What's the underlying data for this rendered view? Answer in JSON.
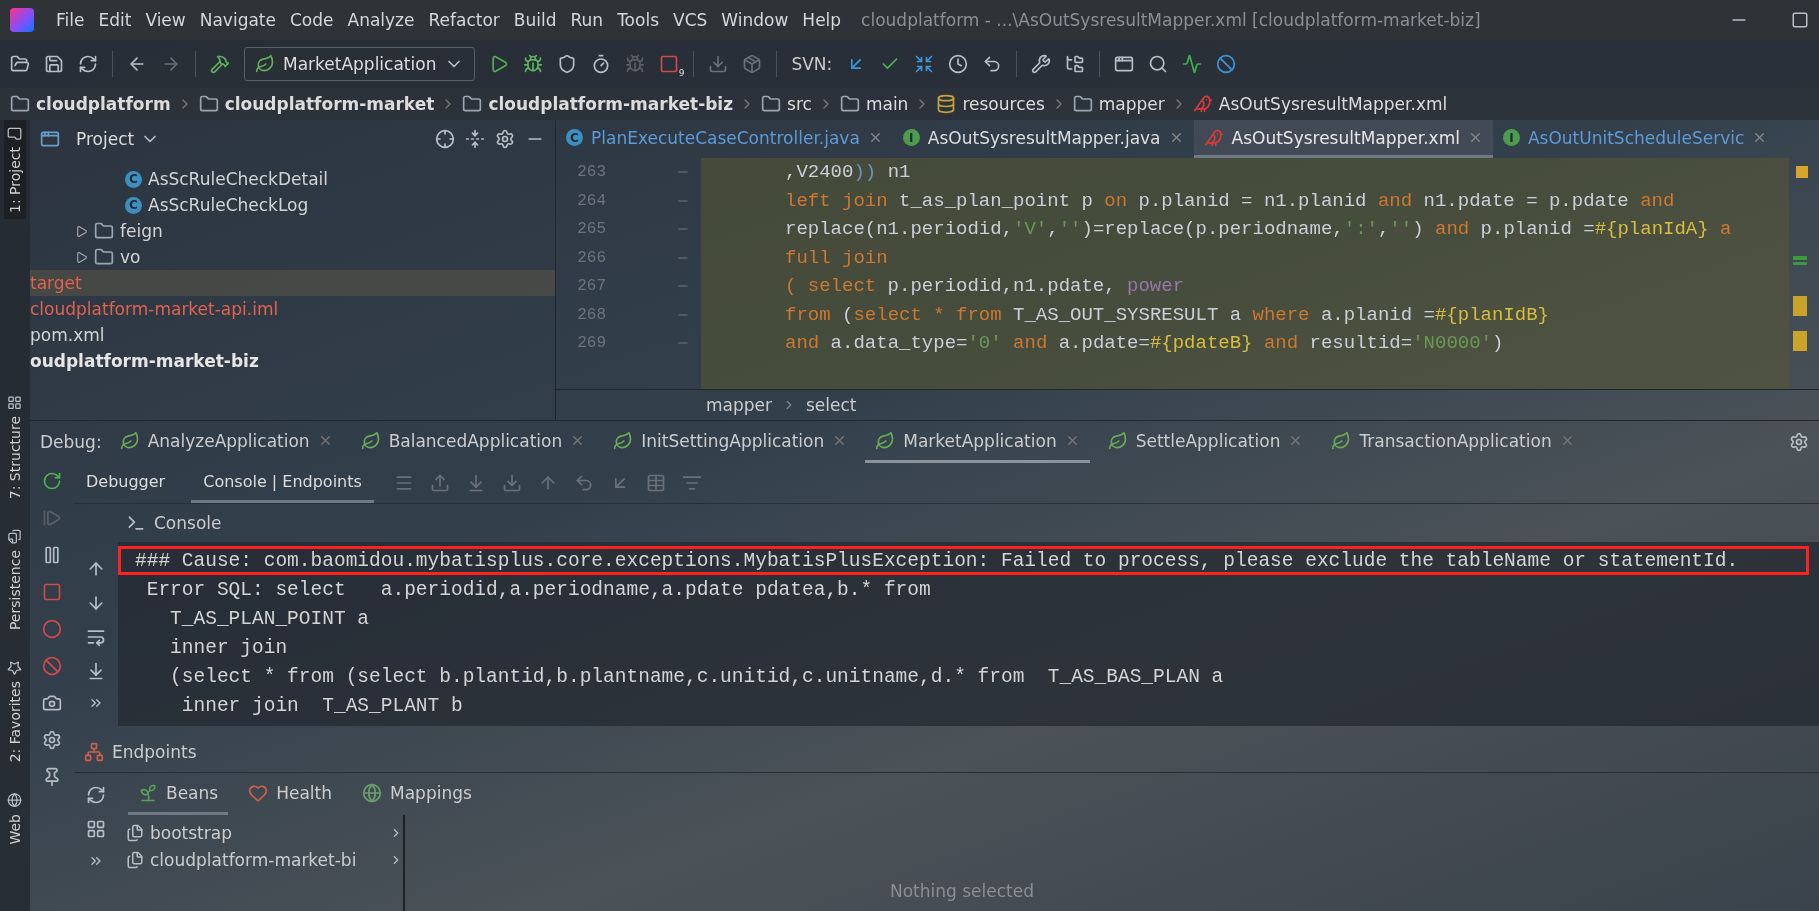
{
  "menu_bar": {
    "items": [
      "File",
      "Edit",
      "View",
      "Navigate",
      "Code",
      "Analyze",
      "Refactor",
      "Build",
      "Run",
      "Tools",
      "VCS",
      "Window",
      "Help"
    ],
    "title": "cloudplatform - ...\\AsOutSysresultMapper.xml [cloudplatform-market-biz]"
  },
  "toolbar": {
    "run_configuration": "MarketApplication",
    "stop_badge": "9",
    "svn_label": "SVN:"
  },
  "breadcrumb": [
    {
      "label": "cloudplatform",
      "kind": "module"
    },
    {
      "label": "cloudplatform-market",
      "kind": "module"
    },
    {
      "label": "cloudplatform-market-biz",
      "kind": "module"
    },
    {
      "label": "src",
      "kind": "folder"
    },
    {
      "label": "main",
      "kind": "folder"
    },
    {
      "label": "resources",
      "kind": "resources"
    },
    {
      "label": "mapper",
      "kind": "folder"
    },
    {
      "label": "AsOutSysresultMapper.xml",
      "kind": "xml"
    }
  ],
  "side_tool_tabs": [
    {
      "label": "1: Project",
      "kind": "project",
      "selected": true
    },
    {
      "label": "7: Structure",
      "kind": "structure",
      "selected": false
    },
    {
      "label": "Persistence",
      "kind": "persistence",
      "selected": false
    },
    {
      "label": "2: Favorites",
      "kind": "favorites",
      "selected": false
    },
    {
      "label": "Web",
      "kind": "web",
      "selected": false
    }
  ],
  "project_panel": {
    "title": "Project",
    "rows": [
      {
        "label": "AsScRuleCheckDetail",
        "kind": "class",
        "icon_letter": "C",
        "selected": false,
        "color": "#d4d4d4"
      },
      {
        "label": "AsScRuleCheckLog",
        "kind": "class",
        "icon_letter": "C",
        "selected": false,
        "color": "#d4d4d4"
      },
      {
        "label": "feign",
        "kind": "folder",
        "expanded": false,
        "selected": false,
        "color": "#d4d4d4"
      },
      {
        "label": "vo",
        "kind": "folder",
        "expanded": false,
        "selected": false,
        "color": "#d4d4d4"
      },
      {
        "label": "target",
        "kind": "file",
        "selected": true,
        "color": "#e0634f"
      },
      {
        "label": "cloudplatform-market-api.iml",
        "kind": "file",
        "selected": false,
        "color": "#e0634f"
      },
      {
        "label": "pom.xml",
        "kind": "file",
        "selected": false,
        "color": "#d4d4d4"
      },
      {
        "label": "oudplatform-market-biz",
        "kind": "module",
        "selected": false,
        "color": "#e6e6e6"
      }
    ]
  },
  "editor": {
    "tabs": [
      {
        "label": "PlanExecuteCaseController.java",
        "kind": "class",
        "icon_letter": "C",
        "selected": false,
        "color": "#5d9ad6"
      },
      {
        "label": "AsOutSysresultMapper.java",
        "kind": "interface",
        "icon_letter": "I",
        "selected": false,
        "color": "#dcdcdc"
      },
      {
        "label": "AsOutSysresultMapper.xml",
        "kind": "xml",
        "selected": true,
        "color": "#e6e6e6"
      },
      {
        "label": "AsOutUnitScheduleServic",
        "kind": "interface",
        "icon_letter": "I",
        "selected": false,
        "color": "#5d9ad6"
      }
    ],
    "lines": [
      {
        "number": "263",
        "tokens": [
          {
            "text": ",V2400",
            "kind": "plain"
          },
          {
            "text": "))",
            "kind": "paren"
          },
          {
            "text": " n1",
            "kind": "plain"
          }
        ]
      },
      {
        "number": "264",
        "tokens": [
          {
            "text": "left join",
            "kind": "kw"
          },
          {
            "text": " t_as_plan_point p ",
            "kind": "plain"
          },
          {
            "text": "on",
            "kind": "kw"
          },
          {
            "text": " p.planid = n1.planid ",
            "kind": "plain"
          },
          {
            "text": "and",
            "kind": "kw"
          },
          {
            "text": " n1.pdate = p.pdate ",
            "kind": "plain"
          },
          {
            "text": "and",
            "kind": "kw"
          }
        ]
      },
      {
        "number": "265",
        "tokens": [
          {
            "text": "replace(n1.periodid,",
            "kind": "plain"
          },
          {
            "text": "'V'",
            "kind": "str"
          },
          {
            "text": ",",
            "kind": "plain"
          },
          {
            "text": "''",
            "kind": "str"
          },
          {
            "text": ")=replace(p.periodname,",
            "kind": "plain"
          },
          {
            "text": "':'",
            "kind": "str"
          },
          {
            "text": ",",
            "kind": "plain"
          },
          {
            "text": "''",
            "kind": "str"
          },
          {
            "text": ") ",
            "kind": "plain"
          },
          {
            "text": "and",
            "kind": "kw"
          },
          {
            "text": " p.planid =",
            "kind": "plain"
          },
          {
            "text": "#{planIdA}",
            "kind": "param"
          },
          {
            "text": " a",
            "kind": "kw"
          }
        ]
      },
      {
        "number": "266",
        "tokens": [
          {
            "text": "full join",
            "kind": "kw"
          }
        ]
      },
      {
        "number": "267",
        "tokens": [
          {
            "text": "( select",
            "kind": "kw"
          },
          {
            "text": " p.periodid,n1.pdate, ",
            "kind": "plain"
          },
          {
            "text": "power",
            "kind": "var"
          }
        ]
      },
      {
        "number": "268",
        "tokens": [
          {
            "text": "from",
            "kind": "kw"
          },
          {
            "text": " (",
            "kind": "plain"
          },
          {
            "text": "select * from",
            "kind": "kw"
          },
          {
            "text": " T_AS_OUT_SYSRESULT a ",
            "kind": "plain"
          },
          {
            "text": "where",
            "kind": "kw"
          },
          {
            "text": " a.planid =",
            "kind": "plain"
          },
          {
            "text": "#{planIdB}",
            "kind": "param"
          }
        ]
      },
      {
        "number": "269",
        "tokens": [
          {
            "text": "and",
            "kind": "kw"
          },
          {
            "text": " a.data_type=",
            "kind": "plain"
          },
          {
            "text": "'0'",
            "kind": "str"
          },
          {
            "text": " and",
            "kind": "kw"
          },
          {
            "text": " a.pdate=",
            "kind": "plain"
          },
          {
            "text": "#{pdateB}",
            "kind": "param"
          },
          {
            "text": " and",
            "kind": "kw"
          },
          {
            "text": " resultid=",
            "kind": "plain"
          },
          {
            "text": "'N0000'",
            "kind": "str"
          },
          {
            "text": ")",
            "kind": "plain"
          }
        ]
      }
    ],
    "breadcrumb": [
      "mapper",
      "select"
    ]
  },
  "debug": {
    "label": "Debug:",
    "sessions": [
      {
        "label": "AnalyzeApplication",
        "selected": false
      },
      {
        "label": "BalancedApplication",
        "selected": false
      },
      {
        "label": "InitSettingApplication",
        "selected": false
      },
      {
        "label": "MarketApplication",
        "selected": true
      },
      {
        "label": "SettleApplication",
        "selected": false
      },
      {
        "label": "TransactionApplication",
        "selected": false
      }
    ],
    "subtabs": [
      {
        "label": "Debugger",
        "selected": false
      },
      {
        "label": "Console | Endpoints",
        "selected": true
      }
    ],
    "console": {
      "title": "Console",
      "lines": [
        {
          "text": "### Cause: com.baomidou.mybatisplus.core.exceptions.MybatisPlusException: Failed to process, please exclude the tableName or statementId.",
          "highlighted": true
        },
        {
          "text": " Error SQL: select   a.periodid,a.periodname,a.pdate pdatea,b.* from",
          "highlighted": false
        },
        {
          "text": "   T_AS_PLAN_POINT a",
          "highlighted": false
        },
        {
          "text": "   inner join",
          "highlighted": false
        },
        {
          "text": "   (select * from (select b.plantid,b.plantname,c.unitid,c.unitname,d.* from  T_AS_BAS_PLAN a",
          "highlighted": false
        },
        {
          "text": "    inner join  T_AS_PLANT b",
          "highlighted": false
        }
      ]
    },
    "endpoints": {
      "title": "Endpoints",
      "tabs": [
        {
          "label": "Beans",
          "kind": "beans",
          "selected": true
        },
        {
          "label": "Health",
          "kind": "health",
          "selected": false
        },
        {
          "label": "Mappings",
          "kind": "mappings",
          "selected": false
        }
      ],
      "items": [
        "bootstrap",
        "cloudplatform-market-bi"
      ],
      "empty_text": "Nothing selected"
    }
  }
}
